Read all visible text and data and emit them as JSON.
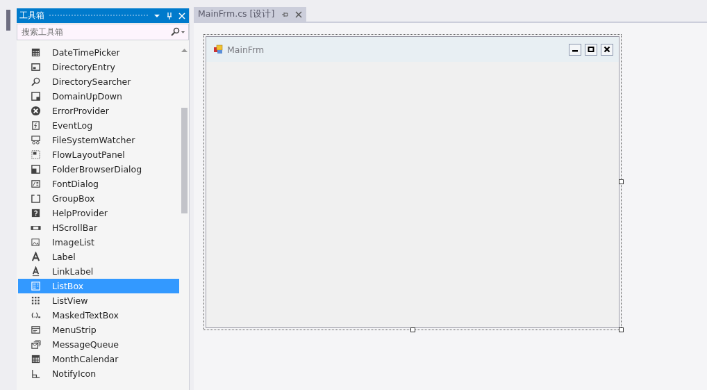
{
  "toolbox": {
    "title": "工具箱",
    "search": {
      "placeholder": "搜索工具箱"
    },
    "items": [
      {
        "label": "DateTimePicker",
        "selected": false
      },
      {
        "label": "DirectoryEntry",
        "selected": false
      },
      {
        "label": "DirectorySearcher",
        "selected": false
      },
      {
        "label": "DomainUpDown",
        "selected": false
      },
      {
        "label": "ErrorProvider",
        "selected": false
      },
      {
        "label": "EventLog",
        "selected": false
      },
      {
        "label": "FileSystemWatcher",
        "selected": false
      },
      {
        "label": "FlowLayoutPanel",
        "selected": false
      },
      {
        "label": "FolderBrowserDialog",
        "selected": false
      },
      {
        "label": "FontDialog",
        "selected": false
      },
      {
        "label": "GroupBox",
        "selected": false
      },
      {
        "label": "HelpProvider",
        "selected": false
      },
      {
        "label": "HScrollBar",
        "selected": false
      },
      {
        "label": "ImageList",
        "selected": false
      },
      {
        "label": "Label",
        "selected": false
      },
      {
        "label": "LinkLabel",
        "selected": false
      },
      {
        "label": "ListBox",
        "selected": true
      },
      {
        "label": "ListView",
        "selected": false
      },
      {
        "label": "MaskedTextBox",
        "selected": false
      },
      {
        "label": "MenuStrip",
        "selected": false
      },
      {
        "label": "MessageQueue",
        "selected": false
      },
      {
        "label": "MonthCalendar",
        "selected": false
      },
      {
        "label": "NotifyIcon",
        "selected": false
      }
    ]
  },
  "document_tab": {
    "label": "MainFrm.cs [设计]",
    "selected": true
  },
  "form": {
    "title": "MainFrm"
  }
}
